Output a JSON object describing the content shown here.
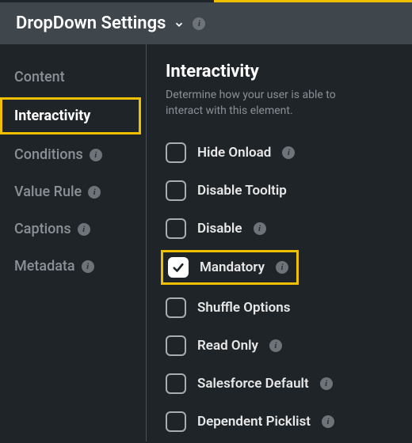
{
  "header": {
    "title": "DropDown Settings"
  },
  "sidebar": {
    "items": [
      {
        "label": "Content",
        "active": false,
        "info": false,
        "highlight": false
      },
      {
        "label": "Interactivity",
        "active": true,
        "info": false,
        "highlight": true
      },
      {
        "label": "Conditions",
        "active": false,
        "info": true,
        "highlight": false
      },
      {
        "label": "Value Rule",
        "active": false,
        "info": true,
        "highlight": false
      },
      {
        "label": "Captions",
        "active": false,
        "info": true,
        "highlight": false
      },
      {
        "label": "Metadata",
        "active": false,
        "info": true,
        "highlight": false
      }
    ]
  },
  "main": {
    "title": "Interactivity",
    "description": "Determine how your user is able to interact with this element.",
    "options": [
      {
        "label": "Hide Onload",
        "checked": false,
        "info": true,
        "highlight": false
      },
      {
        "label": "Disable Tooltip",
        "checked": false,
        "info": false,
        "highlight": false
      },
      {
        "label": "Disable",
        "checked": false,
        "info": true,
        "highlight": false
      },
      {
        "label": "Mandatory",
        "checked": true,
        "info": true,
        "highlight": true
      },
      {
        "label": "Shuffle Options",
        "checked": false,
        "info": false,
        "highlight": false
      },
      {
        "label": "Read Only",
        "checked": false,
        "info": true,
        "highlight": false
      },
      {
        "label": "Salesforce Default",
        "checked": false,
        "info": true,
        "highlight": false
      },
      {
        "label": "Dependent Picklist",
        "checked": false,
        "info": true,
        "highlight": false
      }
    ]
  }
}
